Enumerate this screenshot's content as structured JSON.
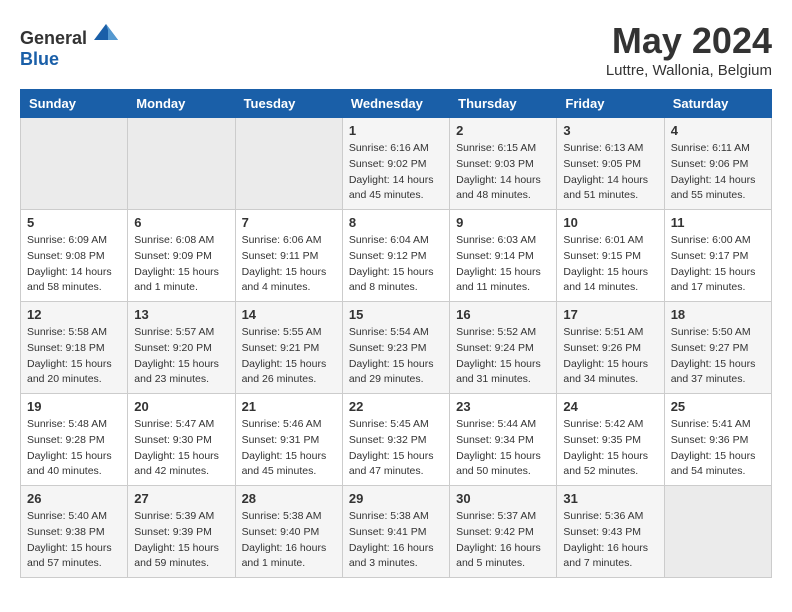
{
  "header": {
    "logo_general": "General",
    "logo_blue": "Blue",
    "month_year": "May 2024",
    "location": "Luttre, Wallonia, Belgium"
  },
  "weekdays": [
    "Sunday",
    "Monday",
    "Tuesday",
    "Wednesday",
    "Thursday",
    "Friday",
    "Saturday"
  ],
  "weeks": [
    [
      {
        "day": "",
        "sunrise": "",
        "sunset": "",
        "daylight": ""
      },
      {
        "day": "",
        "sunrise": "",
        "sunset": "",
        "daylight": ""
      },
      {
        "day": "",
        "sunrise": "",
        "sunset": "",
        "daylight": ""
      },
      {
        "day": "1",
        "sunrise": "Sunrise: 6:16 AM",
        "sunset": "Sunset: 9:02 PM",
        "daylight": "Daylight: 14 hours and 45 minutes."
      },
      {
        "day": "2",
        "sunrise": "Sunrise: 6:15 AM",
        "sunset": "Sunset: 9:03 PM",
        "daylight": "Daylight: 14 hours and 48 minutes."
      },
      {
        "day": "3",
        "sunrise": "Sunrise: 6:13 AM",
        "sunset": "Sunset: 9:05 PM",
        "daylight": "Daylight: 14 hours and 51 minutes."
      },
      {
        "day": "4",
        "sunrise": "Sunrise: 6:11 AM",
        "sunset": "Sunset: 9:06 PM",
        "daylight": "Daylight: 14 hours and 55 minutes."
      }
    ],
    [
      {
        "day": "5",
        "sunrise": "Sunrise: 6:09 AM",
        "sunset": "Sunset: 9:08 PM",
        "daylight": "Daylight: 14 hours and 58 minutes."
      },
      {
        "day": "6",
        "sunrise": "Sunrise: 6:08 AM",
        "sunset": "Sunset: 9:09 PM",
        "daylight": "Daylight: 15 hours and 1 minute."
      },
      {
        "day": "7",
        "sunrise": "Sunrise: 6:06 AM",
        "sunset": "Sunset: 9:11 PM",
        "daylight": "Daylight: 15 hours and 4 minutes."
      },
      {
        "day": "8",
        "sunrise": "Sunrise: 6:04 AM",
        "sunset": "Sunset: 9:12 PM",
        "daylight": "Daylight: 15 hours and 8 minutes."
      },
      {
        "day": "9",
        "sunrise": "Sunrise: 6:03 AM",
        "sunset": "Sunset: 9:14 PM",
        "daylight": "Daylight: 15 hours and 11 minutes."
      },
      {
        "day": "10",
        "sunrise": "Sunrise: 6:01 AM",
        "sunset": "Sunset: 9:15 PM",
        "daylight": "Daylight: 15 hours and 14 minutes."
      },
      {
        "day": "11",
        "sunrise": "Sunrise: 6:00 AM",
        "sunset": "Sunset: 9:17 PM",
        "daylight": "Daylight: 15 hours and 17 minutes."
      }
    ],
    [
      {
        "day": "12",
        "sunrise": "Sunrise: 5:58 AM",
        "sunset": "Sunset: 9:18 PM",
        "daylight": "Daylight: 15 hours and 20 minutes."
      },
      {
        "day": "13",
        "sunrise": "Sunrise: 5:57 AM",
        "sunset": "Sunset: 9:20 PM",
        "daylight": "Daylight: 15 hours and 23 minutes."
      },
      {
        "day": "14",
        "sunrise": "Sunrise: 5:55 AM",
        "sunset": "Sunset: 9:21 PM",
        "daylight": "Daylight: 15 hours and 26 minutes."
      },
      {
        "day": "15",
        "sunrise": "Sunrise: 5:54 AM",
        "sunset": "Sunset: 9:23 PM",
        "daylight": "Daylight: 15 hours and 29 minutes."
      },
      {
        "day": "16",
        "sunrise": "Sunrise: 5:52 AM",
        "sunset": "Sunset: 9:24 PM",
        "daylight": "Daylight: 15 hours and 31 minutes."
      },
      {
        "day": "17",
        "sunrise": "Sunrise: 5:51 AM",
        "sunset": "Sunset: 9:26 PM",
        "daylight": "Daylight: 15 hours and 34 minutes."
      },
      {
        "day": "18",
        "sunrise": "Sunrise: 5:50 AM",
        "sunset": "Sunset: 9:27 PM",
        "daylight": "Daylight: 15 hours and 37 minutes."
      }
    ],
    [
      {
        "day": "19",
        "sunrise": "Sunrise: 5:48 AM",
        "sunset": "Sunset: 9:28 PM",
        "daylight": "Daylight: 15 hours and 40 minutes."
      },
      {
        "day": "20",
        "sunrise": "Sunrise: 5:47 AM",
        "sunset": "Sunset: 9:30 PM",
        "daylight": "Daylight: 15 hours and 42 minutes."
      },
      {
        "day": "21",
        "sunrise": "Sunrise: 5:46 AM",
        "sunset": "Sunset: 9:31 PM",
        "daylight": "Daylight: 15 hours and 45 minutes."
      },
      {
        "day": "22",
        "sunrise": "Sunrise: 5:45 AM",
        "sunset": "Sunset: 9:32 PM",
        "daylight": "Daylight: 15 hours and 47 minutes."
      },
      {
        "day": "23",
        "sunrise": "Sunrise: 5:44 AM",
        "sunset": "Sunset: 9:34 PM",
        "daylight": "Daylight: 15 hours and 50 minutes."
      },
      {
        "day": "24",
        "sunrise": "Sunrise: 5:42 AM",
        "sunset": "Sunset: 9:35 PM",
        "daylight": "Daylight: 15 hours and 52 minutes."
      },
      {
        "day": "25",
        "sunrise": "Sunrise: 5:41 AM",
        "sunset": "Sunset: 9:36 PM",
        "daylight": "Daylight: 15 hours and 54 minutes."
      }
    ],
    [
      {
        "day": "26",
        "sunrise": "Sunrise: 5:40 AM",
        "sunset": "Sunset: 9:38 PM",
        "daylight": "Daylight: 15 hours and 57 minutes."
      },
      {
        "day": "27",
        "sunrise": "Sunrise: 5:39 AM",
        "sunset": "Sunset: 9:39 PM",
        "daylight": "Daylight: 15 hours and 59 minutes."
      },
      {
        "day": "28",
        "sunrise": "Sunrise: 5:38 AM",
        "sunset": "Sunset: 9:40 PM",
        "daylight": "Daylight: 16 hours and 1 minute."
      },
      {
        "day": "29",
        "sunrise": "Sunrise: 5:38 AM",
        "sunset": "Sunset: 9:41 PM",
        "daylight": "Daylight: 16 hours and 3 minutes."
      },
      {
        "day": "30",
        "sunrise": "Sunrise: 5:37 AM",
        "sunset": "Sunset: 9:42 PM",
        "daylight": "Daylight: 16 hours and 5 minutes."
      },
      {
        "day": "31",
        "sunrise": "Sunrise: 5:36 AM",
        "sunset": "Sunset: 9:43 PM",
        "daylight": "Daylight: 16 hours and 7 minutes."
      },
      {
        "day": "",
        "sunrise": "",
        "sunset": "",
        "daylight": ""
      }
    ]
  ]
}
